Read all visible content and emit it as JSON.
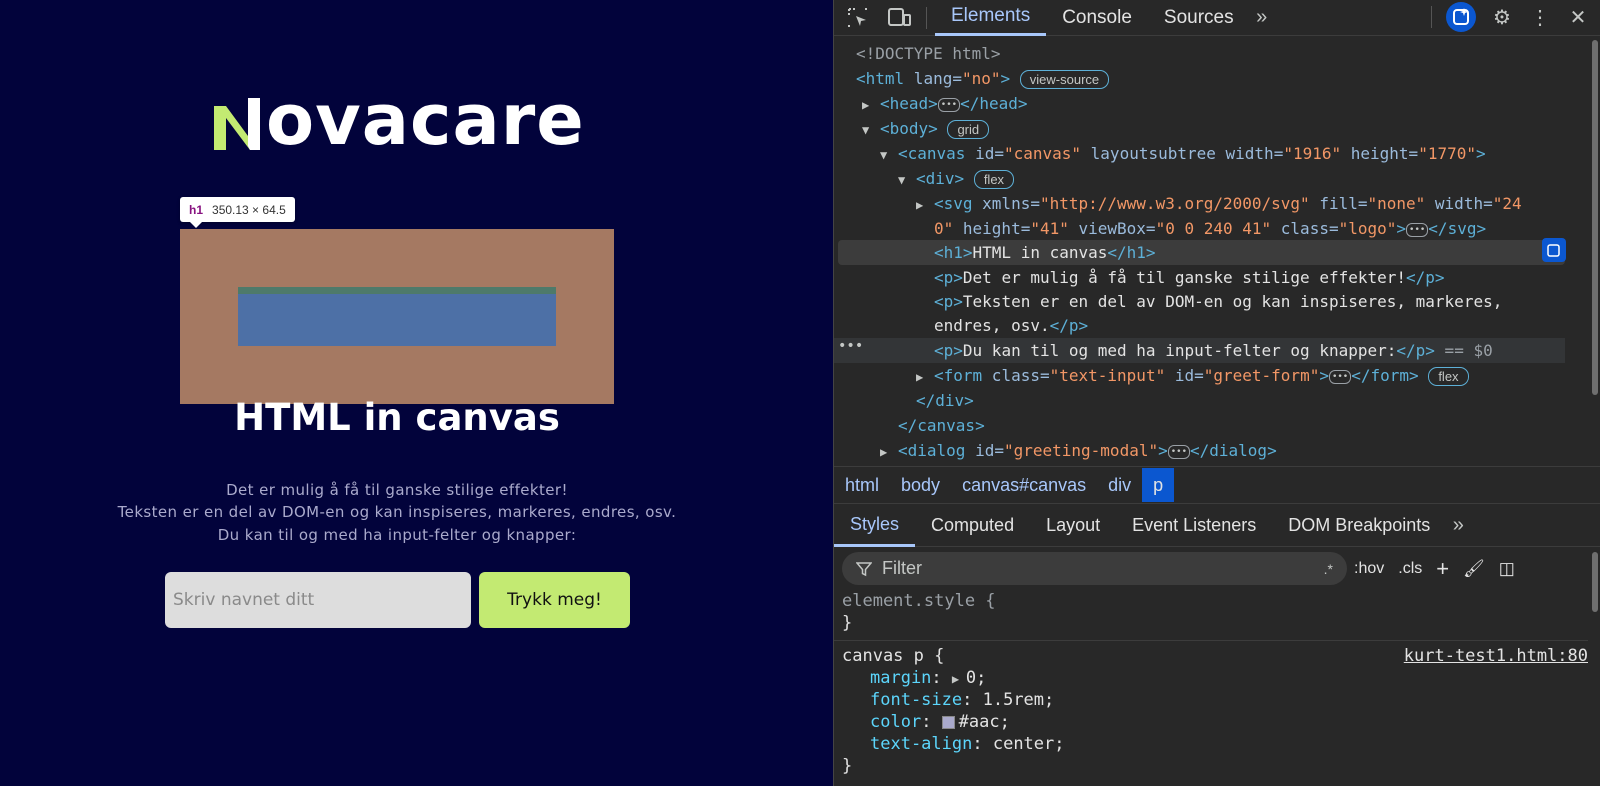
{
  "page": {
    "logo_text": "ovacare",
    "tooltip": {
      "tag": "h1",
      "size": "350.13 × 64.5"
    },
    "h1": "HTML in canvas",
    "paragraphs": [
      "Det er mulig å få til ganske stilige effekter!",
      "Teksten er en del av DOM-en og kan inspiseres, markeres, endres, osv.",
      "Du kan til og med ha input-felter og knapper:"
    ],
    "input_placeholder": "Skriv navnet ditt",
    "button_label": "Trykk meg!",
    "colors": {
      "background": "#02033b",
      "logo_accent": "#c3ea72",
      "highlight": "#a57962",
      "content": "#4d70a6"
    }
  },
  "devtools": {
    "tabs": [
      "Elements",
      "Console",
      "Sources"
    ],
    "dom": {
      "doctype": "<!DOCTYPE html>",
      "html_open": "<html",
      "html_lang_attr": " lang=",
      "html_lang_val": "\"no\"",
      "close_angle": ">",
      "view_source": "view-source",
      "head": "<head>",
      "head_close": "</head>",
      "body": "<body>",
      "grid": "grid",
      "canvas_open": "<canvas",
      "canvas_attrs": " id=",
      "canvas_id": "\"canvas\"",
      "canvas_layout": " layoutsubtree width=",
      "canvas_width": "\"1916\"",
      "canvas_height_attr": " height=",
      "canvas_height": "\"1770\"",
      "div": "<div>",
      "flex": "flex",
      "svg_open": "<svg",
      "svg_xmlns_attr": " xmlns=",
      "svg_xmlns": "\"http://www.w3.org/2000/svg\"",
      "svg_fill_attr": " fill=",
      "svg_fill": "\"none\"",
      "svg_width_attr": " width=",
      "svg_width_a": "\"24",
      "svg_width_b": "0\"",
      "svg_height_attr": " height=",
      "svg_height": "\"41\"",
      "svg_viewbox_attr": " viewBox=",
      "svg_viewbox": "\"0 0 240 41\"",
      "svg_class_attr": " class=",
      "svg_class": "\"logo\"",
      "svg_close": "</svg>",
      "h1_open": "<h1>",
      "h1_text": "HTML in canvas",
      "h1_close": "</h1>",
      "p_open": "<p>",
      "p_close": "</p>",
      "p1": "Det er mulig å få til ganske stilige effekter!",
      "p2a": "Teksten er en del av DOM-en og kan inspiseres, markeres,",
      "p2b": "endres, osv.",
      "p3": "Du kan til og med ha input-felter og knapper:",
      "selected_marker": " == $0",
      "form_open": "<form",
      "form_class_attr": " class=",
      "form_class": "\"text-input\"",
      "form_id_attr": " id=",
      "form_id": "\"greet-form\"",
      "form_close": "</form>",
      "div_close": "</div>",
      "canvas_close": "</canvas>",
      "dialog_open": "<dialog",
      "dialog_id_attr": " id=",
      "dialog_id": "\"greeting-modal\"",
      "dialog_close": "</dialog>"
    },
    "breadcrumbs": [
      "html",
      "body",
      "canvas#canvas",
      "div",
      "p"
    ],
    "subtabs": [
      "Styles",
      "Computed",
      "Layout",
      "Event Listeners",
      "DOM Breakpoints"
    ],
    "filter_placeholder": "Filter",
    "filter_tools": [
      ".*",
      ":hov",
      ".cls"
    ],
    "styles": {
      "element_style": "element.style {",
      "close_brace": "}",
      "selector": "canvas p {",
      "source": "kurt-test1.html:80",
      "rules": [
        {
          "prop": "margin",
          "value": "0;"
        },
        {
          "prop": "font-size",
          "value": "1.5rem;"
        },
        {
          "prop": "color",
          "value": "#aac;"
        },
        {
          "prop": "text-align",
          "value": "center;"
        }
      ]
    }
  }
}
